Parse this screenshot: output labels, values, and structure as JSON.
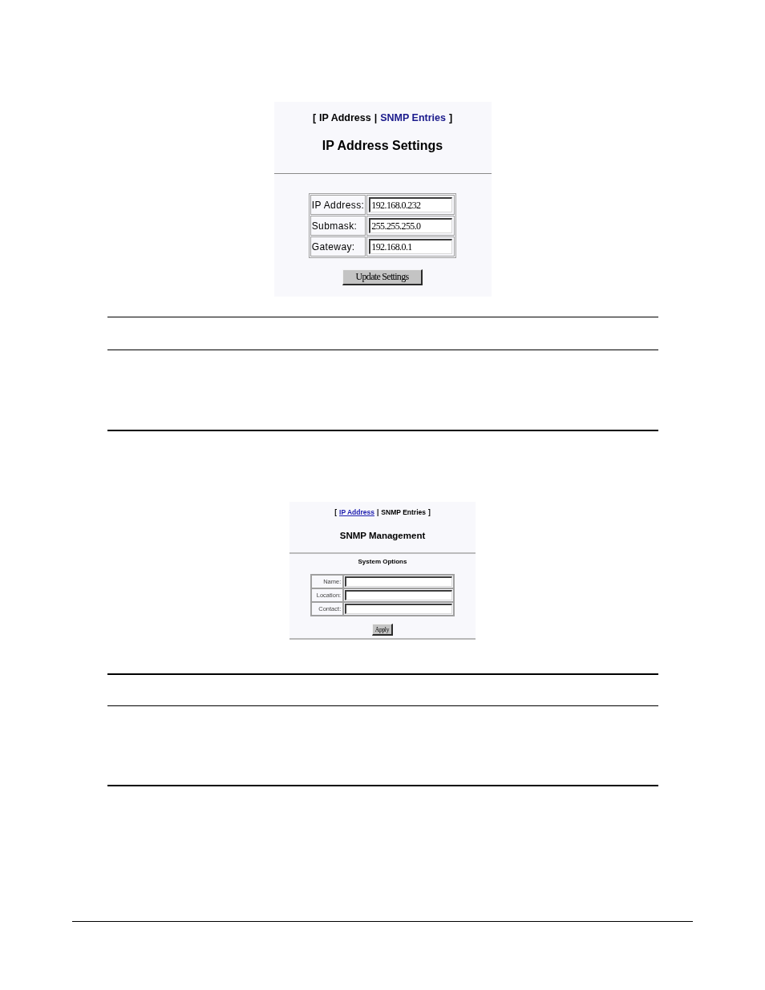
{
  "panels": [
    {
      "nav": {
        "left": "[",
        "separator": "|",
        "right": "]",
        "tabs": [
          {
            "label": "IP Address",
            "selected": true
          },
          {
            "label": "SNMP Entries",
            "selected": false
          }
        ]
      },
      "title": "IP Address Settings",
      "fields": [
        {
          "label": "IP Address:",
          "value": "192.168.0.232"
        },
        {
          "label": "Submask:",
          "value": "255.255.255.0"
        },
        {
          "label": "Gateway:",
          "value": "192.168.0.1"
        }
      ],
      "button": "Update Settings"
    },
    {
      "nav": {
        "left": "[",
        "separator": "|",
        "right": "]",
        "tabs": [
          {
            "label": "IP Address",
            "selected": false
          },
          {
            "label": "SNMP Entries",
            "selected": true
          }
        ]
      },
      "title": "SNMP Management",
      "subtitle": "System Options",
      "fields": [
        {
          "label": "Name:"
        },
        {
          "label": "Location:"
        },
        {
          "label": "Contact:"
        }
      ],
      "button": "Apply"
    }
  ]
}
